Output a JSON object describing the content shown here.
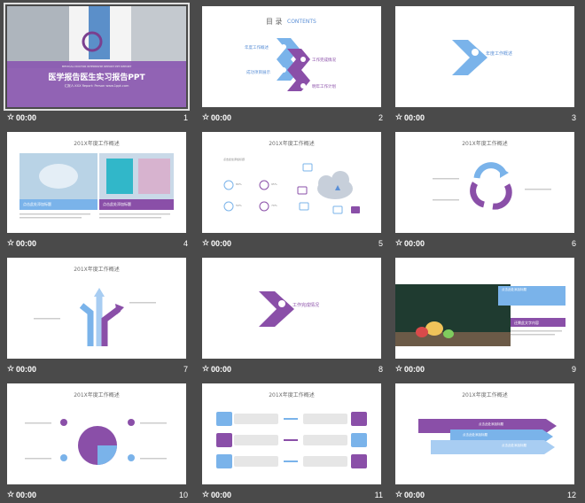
{
  "colors": {
    "background": "#4a4a4a",
    "purple": "#8a4fa8",
    "blue": "#7ab3ea",
    "text": "#ffffff"
  },
  "slides": [
    {
      "num": "1",
      "time": "00:00",
      "title": "医学报告医生实习报告PPT",
      "subtitle": "MEDICAL DOCTOR INTERNSHIP REPORT PPT REPORT",
      "reporter": "汇报人:XXX  Report: Person  www.1ppt.com"
    },
    {
      "num": "2",
      "time": "00:00",
      "title": "目 录",
      "title_en": "CONTENTS",
      "items": [
        "年度工作概述",
        "工作完成情况",
        "成功项目展示",
        "明年工作计划"
      ]
    },
    {
      "num": "3",
      "time": "00:00",
      "section": "年度工作概述"
    },
    {
      "num": "4",
      "time": "00:00",
      "title": "201X年度工作概述",
      "box1": "点击此处添加标题",
      "box2": "点击此处添加标题"
    },
    {
      "num": "5",
      "time": "00:00",
      "title": "201X年度工作概述",
      "heading": "点击此处添加标题",
      "percents": [
        "80%",
        "95%",
        "50%",
        "70%"
      ]
    },
    {
      "num": "6",
      "time": "00:00",
      "title": "201X年度工作概述"
    },
    {
      "num": "7",
      "time": "00:00",
      "title": "201X年度工作概述"
    },
    {
      "num": "8",
      "time": "00:00",
      "section": "工作完成情况"
    },
    {
      "num": "9",
      "time": "00:00",
      "box1": "点击此处添加标题",
      "box2": "还需此文字内容"
    },
    {
      "num": "10",
      "time": "00:00",
      "title": "201X年度工作概述"
    },
    {
      "num": "11",
      "time": "00:00",
      "title": "201X年度工作概述"
    },
    {
      "num": "12",
      "time": "00:00",
      "title": "201X年度工作概述",
      "arrows": [
        "点击此处添加标题",
        "点击此处添加标题",
        "点击此处添加标题"
      ]
    }
  ]
}
